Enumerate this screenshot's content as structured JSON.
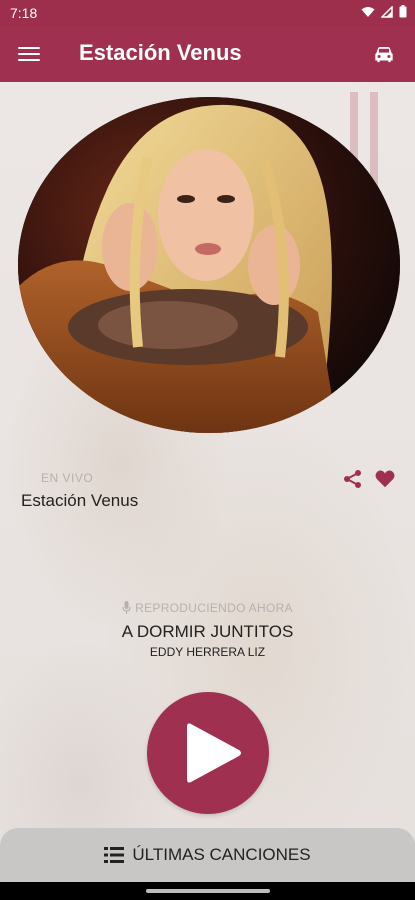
{
  "status_bar": {
    "time": "7:18",
    "icons": [
      "wifi-icon",
      "signal-icon",
      "battery-icon"
    ]
  },
  "app_bar": {
    "title": "Estación Venus",
    "menu_icon": "hamburger-menu-icon",
    "action_icon": "car-icon"
  },
  "station": {
    "live_label": "EN VIVO",
    "name": "Estación Venus"
  },
  "now_playing": {
    "label": "REPRODUCIENDO AHORA",
    "song": "A DORMIR JUNTITOS",
    "artist": "EDDY HERRERA LIZ"
  },
  "bottom_sheet": {
    "label": "ÚLTIMAS CANCIONES"
  },
  "colors": {
    "primary": "#a0304f",
    "status_bar": "#9e2f4c",
    "bottom_bar": "#c9c7c6"
  }
}
